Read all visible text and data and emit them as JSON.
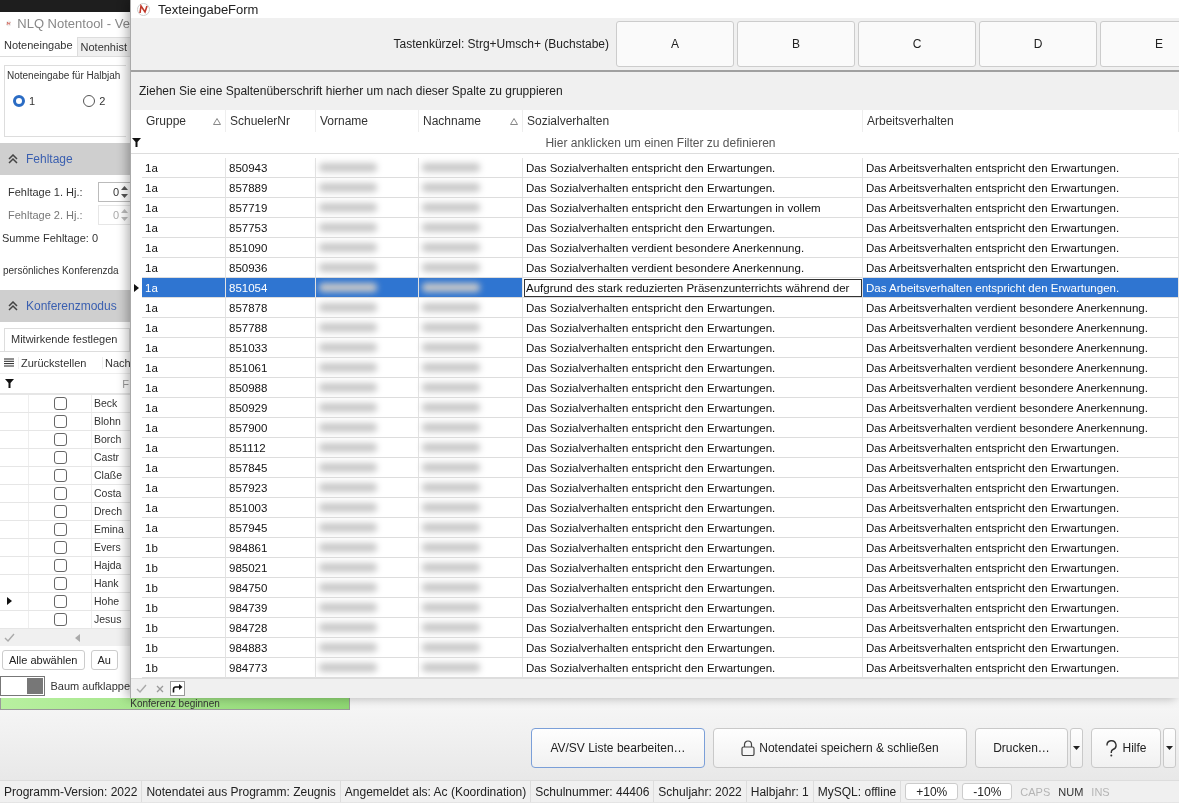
{
  "main_window": {
    "title": "NLQ Notentool - Ve",
    "tabs": [
      {
        "label": "Noteneingabe",
        "selected": true
      },
      {
        "label": "Notenhist",
        "selected": false
      }
    ],
    "halbjahr_group": {
      "label": "Noteneingabe für Halbjah",
      "options": [
        {
          "label": "1",
          "selected": true
        },
        {
          "label": "2",
          "selected": false
        }
      ]
    },
    "fehltage_section": {
      "title": "Fehltage",
      "fields": [
        {
          "label": "Fehltage 1. Hj.:",
          "value": "0",
          "disabled": false
        },
        {
          "label": "Fehltage 2. Hj.:",
          "value": "0",
          "disabled": true
        }
      ],
      "sum_label": "Summe Fehltage:",
      "sum_value": "0",
      "note": "persönliches Konferenzda"
    },
    "konferenz_section": {
      "title": "Konferenzmodus",
      "tab": "Mitwirkende festlegen",
      "columns": [
        "Zurückstellen",
        "Nach"
      ],
      "filter_hint": "F",
      "rows": [
        {
          "name": "Beck",
          "checked": false,
          "current": false
        },
        {
          "name": "Blohn",
          "checked": false,
          "current": false
        },
        {
          "name": "Borch",
          "checked": false,
          "current": false
        },
        {
          "name": "Castr",
          "checked": false,
          "current": false
        },
        {
          "name": "Claße",
          "checked": false,
          "current": false
        },
        {
          "name": "Costa",
          "checked": false,
          "current": false
        },
        {
          "name": "Drech",
          "checked": false,
          "current": false
        },
        {
          "name": "Emina",
          "checked": false,
          "current": false
        },
        {
          "name": "Evers",
          "checked": false,
          "current": false
        },
        {
          "name": "Hajda",
          "checked": false,
          "current": false
        },
        {
          "name": "Hank",
          "checked": false,
          "current": false
        },
        {
          "name": "Hohe",
          "checked": false,
          "current": true
        },
        {
          "name": "Jesus",
          "checked": false,
          "current": false
        }
      ]
    },
    "buttons": [
      "Alle abwählen",
      "Au"
    ],
    "toggle": {
      "label": "Baum aufklappe",
      "on": true
    },
    "start_bar": "Konferenz beginnen"
  },
  "dialog": {
    "title": "TexteingabeForm",
    "shortcut_label": "Tastenkürzel: Strg+Umsch+ (Buchstabe)",
    "letter_buttons": [
      "A",
      "B",
      "C",
      "D",
      "E"
    ],
    "group_hint": "Ziehen Sie eine Spaltenüberschrift hierher um nach dieser Spalte zu gruppieren",
    "columns": [
      {
        "label": "Gruppe",
        "sorted": true
      },
      {
        "label": "SchuelerNr",
        "sorted": false
      },
      {
        "label": "Vorname",
        "sorted": false
      },
      {
        "label": "Nachname",
        "sorted": true
      },
      {
        "label": "Sozialverhalten",
        "sorted": false
      },
      {
        "label": "Arbeitsverhalten",
        "sorted": false
      }
    ],
    "filter_hint": "Hier anklicken um einen Filter zu definieren",
    "rows": [
      {
        "gruppe": "1a",
        "nr": "850943",
        "sozial": "Das Sozialverhalten entspricht den Erwartungen.",
        "arbeits": "Das Arbeitsverhalten entspricht den Erwartungen.",
        "selected": false
      },
      {
        "gruppe": "1a",
        "nr": "857889",
        "sozial": "Das Sozialverhalten entspricht den Erwartungen.",
        "arbeits": "Das Arbeitsverhalten entspricht den Erwartungen.",
        "selected": false
      },
      {
        "gruppe": "1a",
        "nr": "857719",
        "sozial": "Das Sozialverhalten entspricht den Erwartungen in vollem",
        "arbeits": "Das Arbeitsverhalten entspricht den Erwartungen.",
        "selected": false
      },
      {
        "gruppe": "1a",
        "nr": "857753",
        "sozial": "Das Sozialverhalten entspricht den Erwartungen.",
        "arbeits": "Das Arbeitsverhalten entspricht den Erwartungen.",
        "selected": false
      },
      {
        "gruppe": "1a",
        "nr": "851090",
        "sozial": "Das Sozialverhalten verdient besondere Anerkennung.",
        "arbeits": "Das Arbeitsverhalten entspricht den Erwartungen.",
        "selected": false
      },
      {
        "gruppe": "1a",
        "nr": "850936",
        "sozial": "Das Sozialverhalten verdient besondere Anerkennung.",
        "arbeits": "Das Arbeitsverhalten entspricht den Erwartungen.",
        "selected": false
      },
      {
        "gruppe": "1a",
        "nr": "851054",
        "sozial": "Aufgrund des stark reduzierten Präsenzunterrichts während der",
        "arbeits": "Das Arbeitsverhalten entspricht den Erwartungen.",
        "selected": true
      },
      {
        "gruppe": "1a",
        "nr": "857878",
        "sozial": "Das Sozialverhalten entspricht den Erwartungen.",
        "arbeits": "Das Arbeitsverhalten verdient besondere Anerkennung.",
        "selected": false
      },
      {
        "gruppe": "1a",
        "nr": "857788",
        "sozial": "Das Sozialverhalten entspricht den Erwartungen.",
        "arbeits": "Das Arbeitsverhalten verdient besondere Anerkennung.",
        "selected": false
      },
      {
        "gruppe": "1a",
        "nr": "851033",
        "sozial": "Das Sozialverhalten entspricht den Erwartungen.",
        "arbeits": "Das Arbeitsverhalten verdient besondere Anerkennung.",
        "selected": false
      },
      {
        "gruppe": "1a",
        "nr": "851061",
        "sozial": "Das Sozialverhalten entspricht den Erwartungen.",
        "arbeits": "Das Arbeitsverhalten verdient besondere Anerkennung.",
        "selected": false
      },
      {
        "gruppe": "1a",
        "nr": "850988",
        "sozial": "Das Sozialverhalten entspricht den Erwartungen.",
        "arbeits": "Das Arbeitsverhalten verdient besondere Anerkennung.",
        "selected": false
      },
      {
        "gruppe": "1a",
        "nr": "850929",
        "sozial": "Das Sozialverhalten entspricht den Erwartungen.",
        "arbeits": "Das Arbeitsverhalten verdient besondere Anerkennung.",
        "selected": false
      },
      {
        "gruppe": "1a",
        "nr": "857900",
        "sozial": "Das Sozialverhalten entspricht den Erwartungen.",
        "arbeits": "Das Arbeitsverhalten verdient besondere Anerkennung.",
        "selected": false
      },
      {
        "gruppe": "1a",
        "nr": "851112",
        "sozial": "Das Sozialverhalten entspricht den Erwartungen.",
        "arbeits": "Das Arbeitsverhalten entspricht den Erwartungen.",
        "selected": false
      },
      {
        "gruppe": "1a",
        "nr": "857845",
        "sozial": "Das Sozialverhalten entspricht den Erwartungen.",
        "arbeits": "Das Arbeitsverhalten entspricht den Erwartungen.",
        "selected": false
      },
      {
        "gruppe": "1a",
        "nr": "857923",
        "sozial": "Das Sozialverhalten entspricht den Erwartungen.",
        "arbeits": "Das Arbeitsverhalten entspricht den Erwartungen.",
        "selected": false
      },
      {
        "gruppe": "1a",
        "nr": "851003",
        "sozial": "Das Sozialverhalten entspricht den Erwartungen.",
        "arbeits": "Das Arbeitsverhalten entspricht den Erwartungen.",
        "selected": false
      },
      {
        "gruppe": "1a",
        "nr": "857945",
        "sozial": "Das Sozialverhalten entspricht den Erwartungen.",
        "arbeits": "Das Arbeitsverhalten entspricht den Erwartungen.",
        "selected": false
      },
      {
        "gruppe": "1b",
        "nr": "984861",
        "sozial": "Das Sozialverhalten entspricht den Erwartungen.",
        "arbeits": "Das Arbeitsverhalten entspricht den Erwartungen.",
        "selected": false
      },
      {
        "gruppe": "1b",
        "nr": "985021",
        "sozial": "Das Sozialverhalten entspricht den Erwartungen.",
        "arbeits": "Das Arbeitsverhalten entspricht den Erwartungen.",
        "selected": false
      },
      {
        "gruppe": "1b",
        "nr": "984750",
        "sozial": "Das Sozialverhalten entspricht den Erwartungen.",
        "arbeits": "Das Arbeitsverhalten entspricht den Erwartungen.",
        "selected": false
      },
      {
        "gruppe": "1b",
        "nr": "984739",
        "sozial": "Das Sozialverhalten entspricht den Erwartungen.",
        "arbeits": "Das Arbeitsverhalten entspricht den Erwartungen.",
        "selected": false
      },
      {
        "gruppe": "1b",
        "nr": "984728",
        "sozial": "Das Sozialverhalten entspricht den Erwartungen.",
        "arbeits": "Das Arbeitsverhalten entspricht den Erwartungen.",
        "selected": false
      },
      {
        "gruppe": "1b",
        "nr": "984883",
        "sozial": "Das Sozialverhalten entspricht den Erwartungen.",
        "arbeits": "Das Arbeitsverhalten entspricht den Erwartungen.",
        "selected": false
      },
      {
        "gruppe": "1b",
        "nr": "984773",
        "sozial": "Das Sozialverhalten entspricht den Erwartungen.",
        "arbeits": "Das Arbeitsverhalten entspricht den Erwartungen.",
        "selected": false
      }
    ]
  },
  "action_buttons": [
    {
      "label": "AV/SV Liste bearbeiten…",
      "kind": "plain",
      "focused": true
    },
    {
      "label": "Notendatei speichern & schließen",
      "kind": "lock",
      "focused": false
    },
    {
      "label": "Drucken…",
      "kind": "split",
      "focused": false
    },
    {
      "label": "Hilfe",
      "kind": "help",
      "focused": false
    }
  ],
  "status_bar": {
    "fields": [
      "Programm-Version: 2022",
      "Notendatei aus Programm: Zeugnis",
      "Angemeldet als: Ac (Koordination)",
      "Schulnummer: 44406",
      "Schuljahr: 2022",
      "Halbjahr: 1",
      "MySQL: offline"
    ],
    "zoom_buttons": [
      "+10%",
      "-10%"
    ],
    "keys": [
      {
        "label": "CAPS",
        "on": false
      },
      {
        "label": "NUM",
        "on": true
      },
      {
        "label": "INS",
        "on": false
      }
    ]
  }
}
